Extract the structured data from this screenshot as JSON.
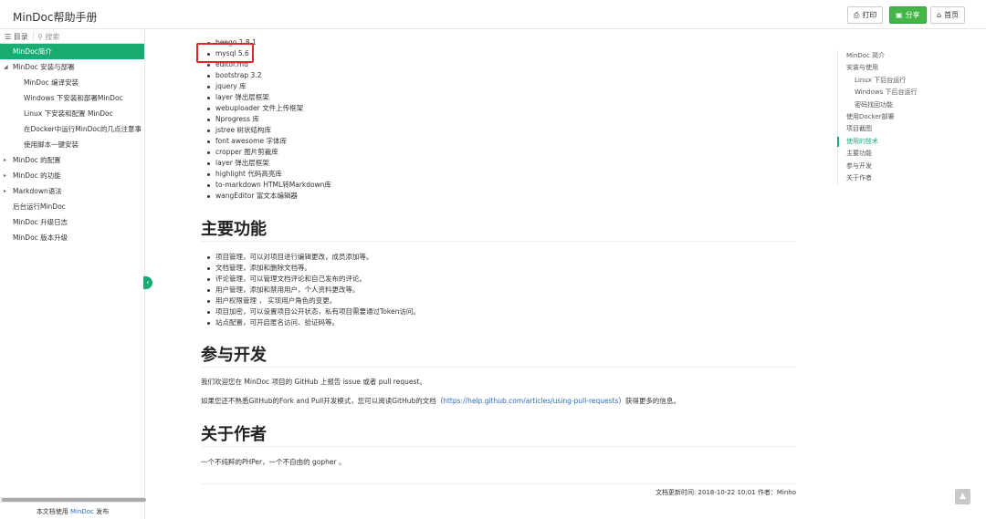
{
  "header": {
    "title": "MinDoc帮助手册",
    "buttons": [
      {
        "icon": "print-icon",
        "glyph": "⎙",
        "label": "打印"
      },
      {
        "icon": "share-icon",
        "glyph": "▣",
        "label": "分享"
      },
      {
        "icon": "home-icon",
        "glyph": "⌂",
        "label": "首页"
      }
    ]
  },
  "sidebar": {
    "tab_toc": "目录",
    "tab_search": "搜索",
    "items": [
      {
        "label": "MinDoc简介"
      },
      {
        "label": "MinDoc 安装与部署"
      },
      {
        "label": "MinDoc 编译安装"
      },
      {
        "label": "Windows 下安装和部署MinDoc"
      },
      {
        "label": "Linux 下安装和配置 MinDoc"
      },
      {
        "label": "在Docker中运行MinDoc的几点注意事"
      },
      {
        "label": "使用脚本一键安装"
      },
      {
        "label": "MinDoc 的配置"
      },
      {
        "label": "MinDoc 的功能"
      },
      {
        "label": "Markdown语法"
      },
      {
        "label": "后台运行MinDoc"
      },
      {
        "label": "MinDoc 升级日志"
      },
      {
        "label": "MinDoc 版本升级"
      }
    ],
    "footer_prefix": "本文档使用",
    "footer_link": "MinDoc",
    "footer_suffix": "发布"
  },
  "content": {
    "deps": [
      "beego 1.8.1",
      "mysql 5.6",
      "editor.md",
      "bootstrap 3.2",
      "jquery 库",
      "layer 弹出层框架",
      "webuploader 文件上传框架",
      "Nprogress 库",
      "jstree 树状结构库",
      "font awesome 字体库",
      "cropper 图片剪裁库",
      "layer 弹出层框架",
      "highlight 代码高亮库",
      "to-markdown HTML转Markdown库",
      "wangEditor 富文本编辑器"
    ],
    "h_features": "主要功能",
    "features": [
      "项目管理，可以对项目进行编辑更改，成员添加等。",
      "文档管理，添加和删除文档等。",
      "评论管理，可以管理文档评论和自己发布的评论。",
      "用户管理，添加和禁用用户，个人资料更改等。",
      "用户权限管理 ， 实现用户角色的变更。",
      "项目加密，可以设置项目公开状态，私有项目需要通过Token访问。",
      "站点配置，可开启匿名访问、验证码等。"
    ],
    "h_contribute": "参与开发",
    "contribute_p1": "我们欢迎您在 MinDoc 项目的 GitHub 上报告 issue 或者 pull request。",
    "contribute_p2_prefix": "如果您还不熟悉GitHub的Fork and Pull开发模式，您可以阅读GitHub的文档（",
    "contribute_p2_link": "https://help.github.com/articles/using-pull-requests",
    "contribute_p2_suffix": "）获得更多的信息。",
    "h_author": "关于作者",
    "author_p": "一个不纯粹的PHPer，一个不自由的 gopher 。",
    "update_meta": "文档更新时间: 2018-10-22 10:01   作者：Minho"
  },
  "outline": {
    "items": [
      {
        "label": "MinDoc 简介"
      },
      {
        "label": "安装与使用"
      },
      {
        "label": "Linux 下后台运行"
      },
      {
        "label": "Windows 下后台运行"
      },
      {
        "label": "密码找回功能"
      },
      {
        "label": "使用Docker部署"
      },
      {
        "label": "项目截图"
      },
      {
        "label": "使用的技术"
      },
      {
        "label": "主要功能"
      },
      {
        "label": "参与开发"
      },
      {
        "label": "关于作者"
      }
    ]
  },
  "colors": {
    "accent": "#1aab73",
    "share_button": "#44b549",
    "highlight_box": "#e0262b",
    "link": "#2b6dc5"
  }
}
